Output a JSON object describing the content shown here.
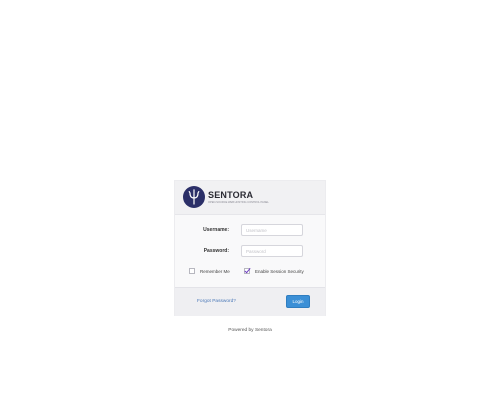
{
  "brand": {
    "name": "SENTORA",
    "tagline": "OPEN-SOURCE WEB HOSTING CONTROL PANEL",
    "logo_icon": "trident-icon",
    "logo_color": "#2b2f68"
  },
  "form": {
    "username_label": "Username:",
    "username_placeholder": "Username",
    "password_label": "Password:",
    "password_placeholder": "Password",
    "remember_label": "Remember Me",
    "remember_checked": false,
    "session_security_label": "Enable Session Security",
    "session_security_checked": true
  },
  "footer": {
    "forgot_password_label": "Forgot Password?",
    "login_label": "Login"
  },
  "powered_by": {
    "prefix": "Powered by",
    "link_label": "Sentora"
  },
  "colors": {
    "accent": "#3b8fd6",
    "link": "#4a78b8"
  }
}
